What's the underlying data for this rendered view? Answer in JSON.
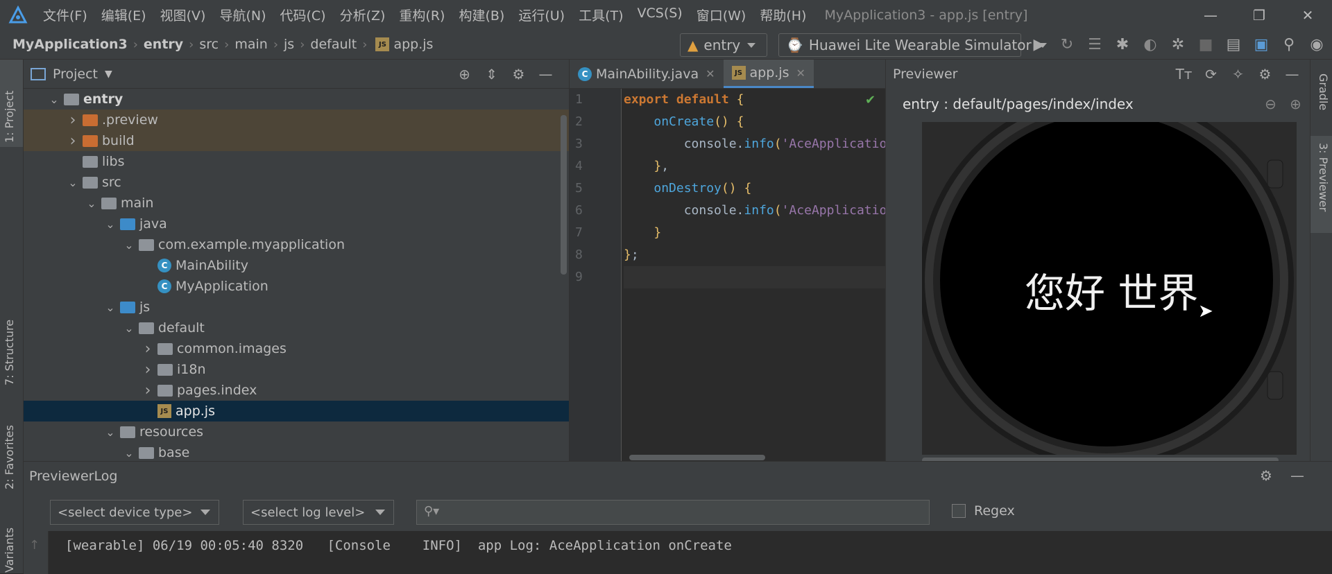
{
  "menubar": {
    "items": [
      "文件(F)",
      "编辑(E)",
      "视图(V)",
      "导航(N)",
      "代码(C)",
      "分析(Z)",
      "重构(R)",
      "构建(B)",
      "运行(U)",
      "工具(T)",
      "VCS(S)",
      "窗口(W)",
      "帮助(H)"
    ],
    "window_title": "MyApplication3 - app.js [entry]",
    "minimize": "—",
    "restore": "❐",
    "close": "✕"
  },
  "breadcrumb": [
    "MyApplication3",
    "entry",
    "src",
    "main",
    "js",
    "default",
    "app.js"
  ],
  "toolbar": {
    "module": "entry",
    "device": "Huawei Lite Wearable Simulator"
  },
  "left_stripe": {
    "project": "1: Project",
    "structure": "7: Structure",
    "favorites": "2: Favorites",
    "variants": "Variants"
  },
  "right_stripe": {
    "gradle": "Gradle",
    "previewer": "3: Previewer"
  },
  "project_panel": {
    "title": "Project",
    "tree": [
      {
        "label": "entry",
        "depth": 0,
        "chevron": "⌄",
        "icon": "module-folder",
        "bold": true
      },
      {
        "label": ".preview",
        "depth": 1,
        "chevron": "›",
        "icon": "orange-folder"
      },
      {
        "label": "build",
        "depth": 1,
        "chevron": "›",
        "icon": "orange-folder"
      },
      {
        "label": "libs",
        "depth": 1,
        "chevron": "",
        "icon": "gray-folder"
      },
      {
        "label": "src",
        "depth": 1,
        "chevron": "⌄",
        "icon": "gray-folder"
      },
      {
        "label": "main",
        "depth": 2,
        "chevron": "⌄",
        "icon": "gray-folder"
      },
      {
        "label": "java",
        "depth": 3,
        "chevron": "⌄",
        "icon": "blue-folder"
      },
      {
        "label": "com.example.myapplication",
        "depth": 4,
        "chevron": "⌄",
        "icon": "package-folder"
      },
      {
        "label": "MainAbility",
        "depth": 5,
        "chevron": "",
        "icon": "class-icon"
      },
      {
        "label": "MyApplication",
        "depth": 5,
        "chevron": "",
        "icon": "class-icon"
      },
      {
        "label": "js",
        "depth": 3,
        "chevron": "⌄",
        "icon": "blue-folder"
      },
      {
        "label": "default",
        "depth": 4,
        "chevron": "⌄",
        "icon": "gray-folder"
      },
      {
        "label": "common.images",
        "depth": 5,
        "chevron": "›",
        "icon": "gray-folder"
      },
      {
        "label": "i18n",
        "depth": 5,
        "chevron": "›",
        "icon": "gray-folder"
      },
      {
        "label": "pages.index",
        "depth": 5,
        "chevron": "›",
        "icon": "gray-folder"
      },
      {
        "label": "app.js",
        "depth": 5,
        "chevron": "",
        "icon": "js-file-icon",
        "selected": true
      },
      {
        "label": "resources",
        "depth": 3,
        "chevron": "⌄",
        "icon": "resources-folder"
      },
      {
        "label": "base",
        "depth": 4,
        "chevron": "⌄",
        "icon": "gray-folder"
      }
    ]
  },
  "editor": {
    "tabs": [
      {
        "label": "MainAbility.java",
        "active": false
      },
      {
        "label": "app.js",
        "active": true
      }
    ],
    "line_numbers": [
      "1",
      "2",
      "3",
      "4",
      "5",
      "6",
      "7",
      "8",
      "9"
    ]
  },
  "previewer": {
    "title": "Previewer",
    "path": "entry : default/pages/index/index",
    "screen_text": "您好 世界"
  },
  "log": {
    "title": "PreviewerLog",
    "device_select": "<select device type>",
    "level_select": "<select log level>",
    "search_placeholder": "",
    "regex_label": "Regex",
    "line": "[wearable] 06/19 00:05:40 8320   [Console    INFO]  app Log: AceApplication onCreate"
  },
  "colors": {
    "accent": "#4a88c7",
    "selection": "#0d293e",
    "keyword": "#cc7832",
    "string": "#6a8759",
    "method": "#9876aa"
  }
}
